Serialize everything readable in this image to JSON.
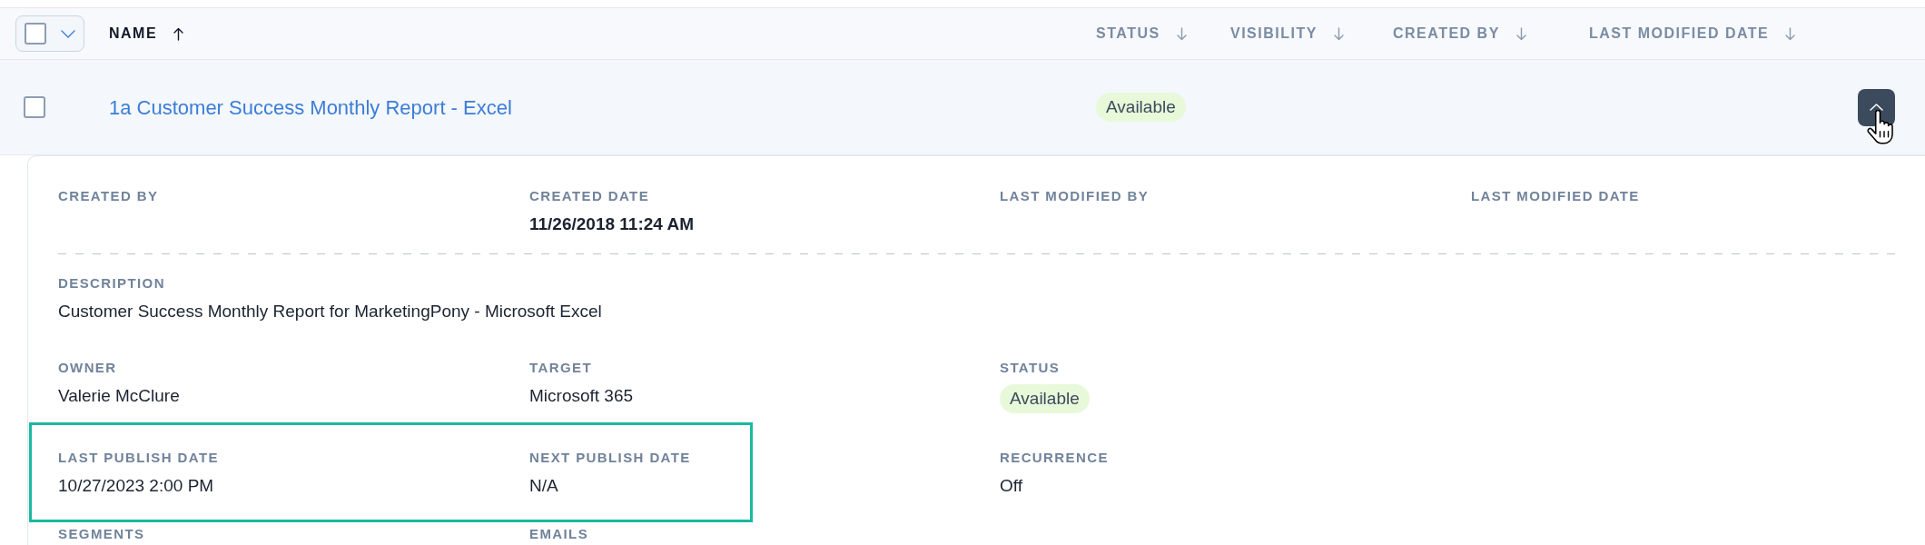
{
  "table": {
    "select_all": {
      "checked": false
    },
    "columns": [
      {
        "label": "NAME",
        "ascending": true,
        "active": true
      },
      {
        "label": "STATUS",
        "ascending": false,
        "active": false
      },
      {
        "label": "VISIBILITY",
        "ascending": false,
        "active": false
      },
      {
        "label": "CREATED BY",
        "ascending": false,
        "active": false
      },
      {
        "label": "LAST MODIFIED DATE",
        "ascending": false,
        "active": false
      }
    ],
    "rows": [
      {
        "checked": false,
        "name": "1a Customer Success Monthly Report - Excel",
        "status": "Available",
        "expanded": true,
        "details": {
          "sections": [
            {
              "rows": [
                {
                  "fields": [
                    {
                      "label": "CREATED BY",
                      "highlighted": false
                    },
                    {
                      "label": "CREATED DATE",
                      "value": "11/26/2018 11:24 AM",
                      "kind": "strong",
                      "highlighted": false
                    },
                    {
                      "label": "LAST MODIFIED BY",
                      "highlighted": false
                    },
                    {
                      "label": "LAST MODIFIED DATE",
                      "highlighted": false
                    }
                  ]
                }
              ]
            },
            {
              "rows": [
                {
                  "fields": [
                    {
                      "label": "DESCRIPTION",
                      "value": "Customer Success Monthly Report for MarketingPony - Microsoft Excel",
                      "kind": "text",
                      "highlighted": false
                    }
                  ]
                },
                {
                  "fields": [
                    {
                      "label": "OWNER",
                      "value": "Valerie McClure",
                      "kind": "text",
                      "highlighted": false
                    },
                    {
                      "label": "TARGET",
                      "value": "Microsoft 365",
                      "kind": "text",
                      "highlighted": false
                    },
                    {
                      "label": "STATUS",
                      "value": "Available",
                      "kind": "badge",
                      "highlighted": false
                    }
                  ]
                },
                {
                  "fields": [
                    {
                      "label": "LAST PUBLISH DATE",
                      "value": "10/27/2023 2:00 PM",
                      "kind": "text",
                      "highlighted": true
                    },
                    {
                      "label": "NEXT PUBLISH DATE",
                      "value": "N/A",
                      "kind": "text",
                      "highlighted": true
                    },
                    {
                      "label": "RECURRENCE",
                      "value": "Off",
                      "kind": "text",
                      "highlighted": false
                    }
                  ]
                },
                {
                  "fields": [
                    {
                      "label": "SEGMENTS",
                      "highlighted": false
                    },
                    {
                      "label": "EMAILS",
                      "highlighted": false
                    }
                  ]
                }
              ]
            }
          ]
        }
      }
    ]
  }
}
